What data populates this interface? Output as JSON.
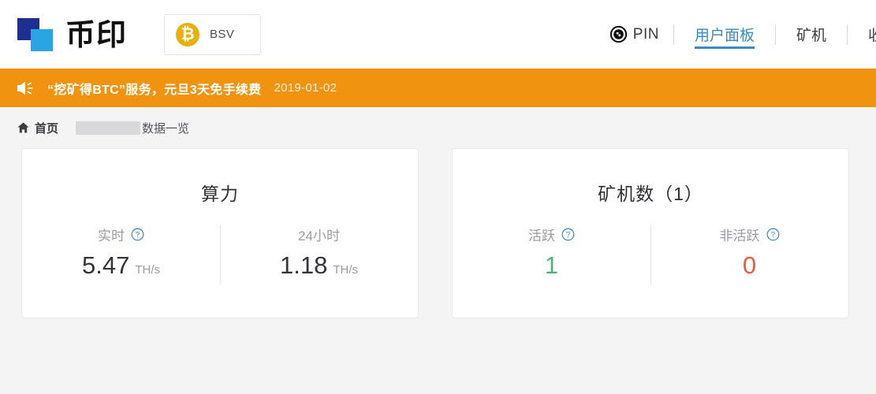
{
  "header": {
    "logo_text": "币印",
    "coin_selector": {
      "icon": "bitcoin-icon",
      "symbol": "₿",
      "label": "BSV"
    },
    "nav": {
      "pin": {
        "icon": "pin-coin-icon",
        "label": "PIN"
      },
      "items": [
        {
          "label": "用户面板",
          "active": true
        },
        {
          "label": "矿机",
          "active": false
        },
        {
          "label": "收",
          "active": false,
          "clipped": true
        }
      ]
    }
  },
  "banner": {
    "icon": "speaker-icon",
    "text": "“挖矿得BTC”服务，元旦3天免手续费",
    "date": "2019-01-02"
  },
  "breadcrumb": {
    "home_icon": "home-icon",
    "home_label": "首页",
    "redacted": "",
    "tail_label": "数据一览"
  },
  "cards": [
    {
      "name": "hashrate-card",
      "title": "算力",
      "columns": [
        {
          "name": "realtime",
          "label": "实时",
          "has_help": true,
          "value": "5.47",
          "unit": "TH/s",
          "color": "#33333b"
        },
        {
          "name": "24hour",
          "label": "24小时",
          "has_help": false,
          "value": "1.18",
          "unit": "TH/s",
          "color": "#33333b"
        }
      ]
    },
    {
      "name": "miner-count-card",
      "title": "矿机数（1）",
      "columns": [
        {
          "name": "active",
          "label": "活跃",
          "has_help": true,
          "value": "1",
          "unit": "",
          "color": "#4cb571"
        },
        {
          "name": "inactive",
          "label": "非活跃",
          "has_help": true,
          "value": "0",
          "unit": "",
          "color": "#f9553d"
        }
      ]
    }
  ],
  "colors": {
    "banner_orange": "#ef9311",
    "accent_blue": "#3a8ac8",
    "logo_dark_blue": "#1f2f8f",
    "logo_light_blue": "#2ba4e3",
    "coin_gold": "#e8b00f",
    "active_green": "#4cb571",
    "inactive_red": "#f9553d",
    "page_bg": "#f4f4f5"
  }
}
